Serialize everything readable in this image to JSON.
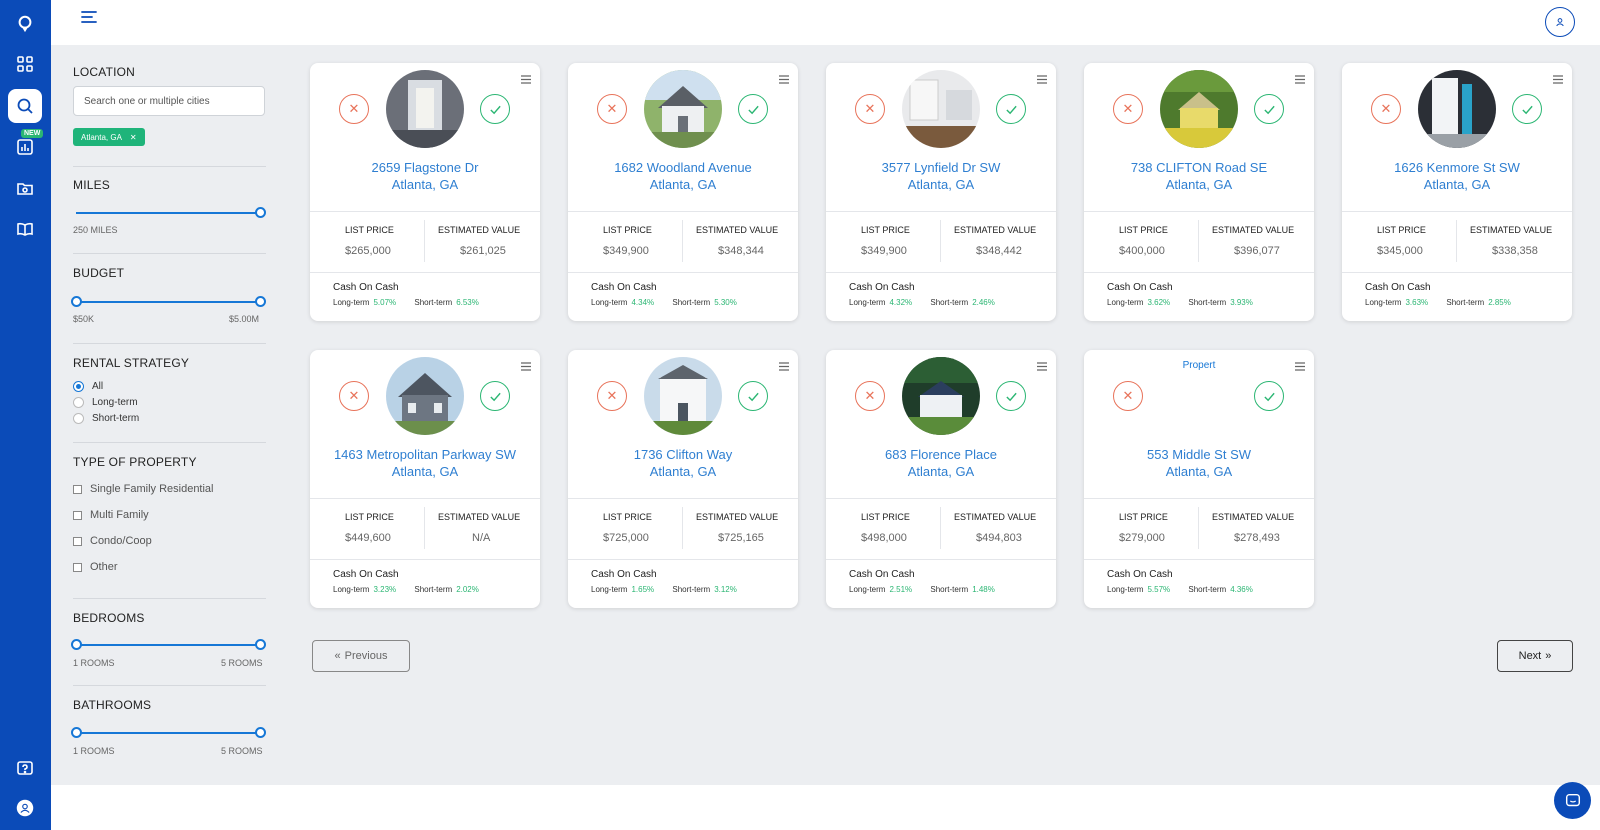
{
  "rail": {
    "badge_new": "NEW",
    "icons": [
      "logo-pin-icon",
      "dashboard-grid-icon",
      "search-icon",
      "analytics-chart-icon",
      "folder-dollar-icon",
      "book-icon",
      "help-icon",
      "user-avatar-icon"
    ]
  },
  "filters": {
    "location": {
      "title": "LOCATION",
      "placeholder": "Search one or multiple cities",
      "chip": "Atlanta, GA"
    },
    "miles": {
      "title": "MILES",
      "value_label": "250 MILES",
      "fraction": 1.0
    },
    "budget": {
      "title": "BUDGET",
      "min_label": "$50K",
      "max_label": "$5.00M",
      "low": 0.0,
      "high": 1.0
    },
    "rental_strategy": {
      "title": "RENTAL STRATEGY",
      "options": [
        "All",
        "Long-term",
        "Short-term"
      ],
      "selected": "All"
    },
    "property_type": {
      "title": "TYPE OF PROPERTY",
      "options": [
        "Single Family Residential",
        "Multi Family",
        "Condo/Coop",
        "Other"
      ]
    },
    "bedrooms": {
      "title": "BEDROOMS",
      "min_label": "1 ROOMS",
      "max_label": "5 ROOMS"
    },
    "bathrooms": {
      "title": "BATHROOMS",
      "min_label": "1 ROOMS",
      "max_label": "5 ROOMS"
    }
  },
  "labels": {
    "list_price": "LIST PRICE",
    "estimated_value": "ESTIMATED VALUE",
    "cash_on_cash": "Cash On Cash",
    "long_term": "Long-term",
    "short_term": "Short-term"
  },
  "cards": [
    {
      "street": "2659 Flagstone Dr",
      "city": "Atlanta, GA",
      "list_price": "$265,000",
      "estimated_value": "$261,025",
      "long_term": "5.07%",
      "short_term": "6.53%",
      "photo": "interior-hallway"
    },
    {
      "street": "1682 Woodland Avenue",
      "city": "Atlanta, GA",
      "list_price": "$349,900",
      "estimated_value": "$348,344",
      "long_term": "4.34%",
      "short_term": "5.30%",
      "photo": "white-house"
    },
    {
      "street": "3577 Lynfield Dr SW",
      "city": "Atlanta, GA",
      "list_price": "$349,900",
      "estimated_value": "$348,442",
      "long_term": "4.32%",
      "short_term": "2.46%",
      "photo": "interior-kitchen"
    },
    {
      "street": "738 CLIFTON Road SE",
      "city": "Atlanta, GA",
      "list_price": "$400,000",
      "estimated_value": "$396,077",
      "long_term": "3.62%",
      "short_term": "3.93%",
      "photo": "yellow-house"
    },
    {
      "street": "1626 Kenmore St SW",
      "city": "Atlanta, GA",
      "list_price": "$345,000",
      "estimated_value": "$338,358",
      "long_term": "3.63%",
      "short_term": "2.85%",
      "photo": "interior-room"
    },
    {
      "street": "1463 Metropolitan Parkway SW",
      "city": "Atlanta, GA",
      "list_price": "$449,600",
      "estimated_value": "N/A",
      "long_term": "3.23%",
      "short_term": "2.02%",
      "photo": "gray-house"
    },
    {
      "street": "1736 Clifton Way",
      "city": "Atlanta, GA",
      "list_price": "$725,000",
      "estimated_value": "$725,165",
      "long_term": "1.65%",
      "short_term": "3.12%",
      "photo": "white-two-story"
    },
    {
      "street": "683 Florence Place",
      "city": "Atlanta, GA",
      "list_price": "$498,000",
      "estimated_value": "$494,803",
      "long_term": "2.51%",
      "short_term": "1.48%",
      "photo": "blue-house"
    },
    {
      "street": "553 Middle St SW",
      "city": "Atlanta, GA",
      "list_price": "$279,000",
      "estimated_value": "$278,493",
      "long_term": "5.57%",
      "short_term": "4.36%",
      "photo": "none",
      "photo_alt": "Propert"
    }
  ],
  "pagination": {
    "previous": "Previous",
    "next": "Next"
  },
  "colors": {
    "brand": "#0b4bb8",
    "accent": "#1677d6",
    "positive": "#2bb673",
    "reject": "#e8735a"
  }
}
